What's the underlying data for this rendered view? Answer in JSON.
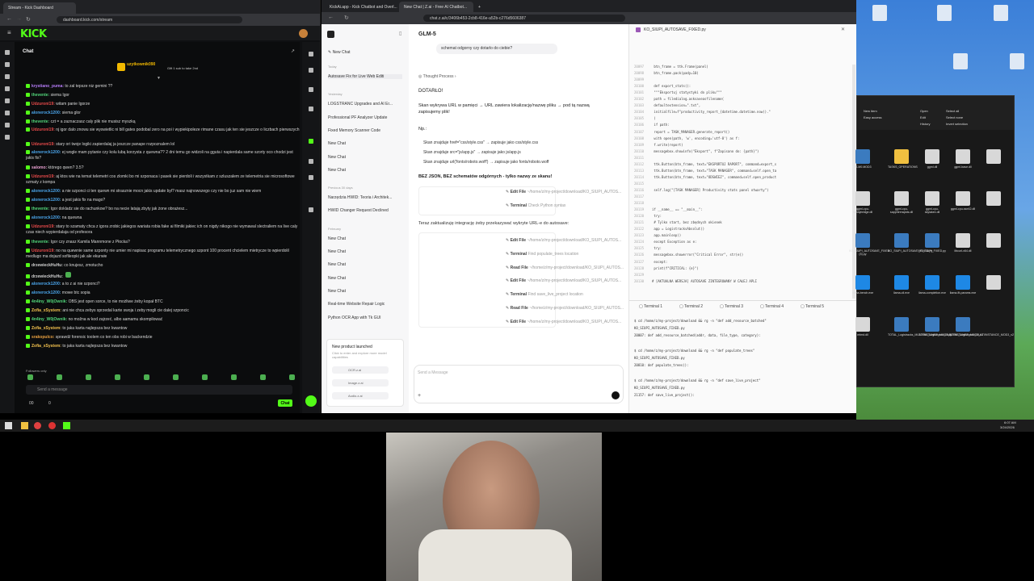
{
  "colors": {
    "kick": "#53fc18",
    "accent": "#2d6cdf"
  },
  "left_browser": {
    "tab": "Stream - Kick Dashboard",
    "url": "dashboard.kick.com/stream",
    "logo": "KICK",
    "chat_title": "Chat",
    "pinned_user": "uzytkownik090",
    "pinned_text": "Gift 1 sub to take 2nd",
    "messages": [
      {
        "u": "krystiano_puma:",
        "t": "to zal tepsze niz gemini ??",
        "c": "#b57cf7"
      },
      {
        "u": "thevente:",
        "t": "siema Igor",
        "c": "#52d67a"
      },
      {
        "u": "Udzuroni19:",
        "t": "witam panie Igorze",
        "c": "#e84a4a"
      },
      {
        "u": "alonerock1200:",
        "t": "siema glor",
        "c": "#4aa3e8"
      },
      {
        "u": "thevente:",
        "t": "czt = a zaznaczasz caly plik nie musisz myszką",
        "c": "#52d67a"
      },
      {
        "u": "Udzuroni19:",
        "t": "nj igor dalo znowu sie wyswietlic ni bill gates podobal zero na poi i wypiekipoleze rimane czasu jak ten sie jeszcze o liczbach pierwszych",
        "c": "#e84a4a"
      },
      {
        "u": "Udzuroni19:",
        "t": "stary ori twoje logiki zapierdalaj ja jeszcze panape rozpoznalem lol",
        "c": "#e84a4a"
      },
      {
        "u": "alonerock1200:",
        "t": "ej wogle mam pytanie czy kolu lubą korzysta z quewna?? 2 dni temu go widzoli na gguta i napierdala same szorty oco chodzi jest jakis fix?",
        "c": "#4aa3e8"
      },
      {
        "u": "salomo:",
        "t": "którego qwen? 3.5?",
        "c": "#e8a0d0"
      },
      {
        "u": "Udzuroni19:",
        "t": "aj ktos wie na temat telemetri cos zlomki bo mi szponaca i pasek sie pierdoli i wszystkam z szluszalem ze telemetria sie microsoftowe szmaty z kompa",
        "c": "#e84a4a"
      },
      {
        "u": "alonerock1200:",
        "t": "a nie szponci ci ten quewn mi strasznie mocn jakis update byl? masz najnowszego czy nie bo juz sam nie wiem",
        "c": "#4aa3e8"
      },
      {
        "u": "alonerock1200:",
        "t": "a jest jakis fix na mago?",
        "c": "#4aa3e8"
      },
      {
        "u": "thevente:",
        "t": "Igor dokladz sie do rachunkow? bo na necie latają zbyty jak żone obrażesz...",
        "c": "#52d67a"
      },
      {
        "u": "alonerock1200:",
        "t": "na quewna",
        "c": "#4aa3e8"
      },
      {
        "u": "Udzuroni19:",
        "t": "stary to szamaty chca z igora zrobic jakiegos wariata robia fake ai filmiki jakiec ich on nigdy nikogo nie wymawal slectraliem na live caly czas niech wypierdalaja od profesora",
        "c": "#e84a4a"
      },
      {
        "u": "thevente:",
        "t": "Igor czy znasz Kamila Mannmone z Płocka?",
        "c": "#52d67a"
      },
      {
        "u": "Udzuroni19:",
        "t": "no na quewnie same szponty nie umier mi napisac programu telemetrycznego szpont 100 procent chcielem mietrycze to wpierdolil medlugo ma dojazd sofileopki jak ale ekurwie",
        "c": "#e84a4a"
      },
      {
        "u": "drzewieckHuHu:",
        "t": "co knujesz, zmotucho",
        "c": "#d0d0d0"
      },
      {
        "u": "drzewieckHuHu:",
        "t": "",
        "c": "#d0d0d0"
      },
      {
        "u": "alonerock1200:",
        "t": "a to z ai nie szponci?",
        "c": "#4aa3e8"
      },
      {
        "u": "alonerock1200:",
        "t": "mowe btc sopia",
        "c": "#4aa3e8"
      },
      {
        "u": "4n4iny_W0jOwnik:",
        "t": "OBS jest open sorce, to nie możliwe żeby kopał BTC",
        "c": "#52d67a"
      },
      {
        "u": "Zofia_xSystem:",
        "t": "ani nie chca zebys sprzedal karte swoja i zeby mogli cie dalej szponcic",
        "c": "#f2c14e"
      },
      {
        "u": "4n4iny_W0jOwnik:",
        "t": "no možna w kod zajrzeć, albo aamamu skompilować",
        "c": "#52d67a"
      },
      {
        "u": "Zofia_xSystem:",
        "t": "to jaka karta najlepsza bez kwantow",
        "c": "#f2c14e"
      },
      {
        "u": "srakopulco:",
        "t": "sprawdź forensic toolem co ten obs robi w backendzie",
        "c": "#e8a040"
      },
      {
        "u": "Zofia_xSystem:",
        "t": "to jaka karta najlepsza bez kwantow",
        "c": "#f2c14e"
      }
    ],
    "followers_only": "Followers only",
    "send_placeholder": "Send a message",
    "count_a": "00",
    "count_b": "0",
    "chat_button": "Chat"
  },
  "middle_browser": {
    "tabs": [
      "KickAi.app - Kick Chatbot and Overl...",
      "New Chat | Z.ai - Free AI Chatbot...",
      "+"
    ],
    "url": "chat.z.ai/c/3406b453-2cb8-416e-a52b-c276d5606387",
    "model": "GLM-5",
    "sidebar": {
      "new_chat": "New Chat",
      "sections": [
        {
          "h": "Today",
          "items": [
            "Autosave Fix for Live Web Editi"
          ]
        },
        {
          "h": "Yesterday",
          "items": [
            "LOGSTRANC Upgrades and AI Er...",
            "Professional PF Analyzer Update",
            "Fixed Memory Scanner Code",
            "New Chat",
            "New Chat",
            "New Chat"
          ]
        },
        {
          "h": "Previous 30 days",
          "items": [
            "Narzędzia HWID: Teoria i Architek...",
            "HWID Changer Request Declined"
          ]
        },
        {
          "h": "February",
          "items": [
            "New Chat",
            "New Chat",
            "New Chat",
            "New Chat",
            "New Chat",
            "Real-time Website Repair Logic",
            "Python OCR App with Tk GUI"
          ]
        }
      ],
      "promo_title": "New product launched",
      "promo_text": "Click to enter and explore more model capabilities",
      "promo_items": [
        "OCR.z.ai",
        "Image.z.ai",
        "Audio.z.ai"
      ]
    },
    "chat": {
      "user_msg": "schemat odgorny czy dotarlo do ciebie?",
      "thinking": "Thought Process",
      "p1": "DOTARŁO!",
      "p2": "Skan wykrywa URL w pamięci → URL zawiera lokalizację/nazwę pliku → pod tą nazwą zapisujemy plik!",
      "np": "Np.:",
      "bullets": [
        "Skan znajduje href=\"css/style.css\" → zapisuje jako css/style.css",
        "Skan znajduje src=\"js/app.js\" → zapisuje jako js/app.js",
        "Skan znajduje url('fonts/roboto.woff') → zapisuje jako fonts/roboto.woff"
      ],
      "bold_note": "BEZ JSON, BEZ schematów odgórnych - tylko nazwy ze skanu!",
      "tools1": [
        [
          "Edit File",
          "~/home/z/my-project/download/KO_SIUPI_AUTOS..."
        ],
        [
          "Terminal",
          "Check Python syntax"
        ]
      ],
      "p3": "Teraz zaktualizuję integrację żeby przekazywać wykryte URL-e do autosave:",
      "tools2": [
        [
          "Edit File",
          "~/home/z/my-project/download/KO_SIUPI_AUTOS..."
        ],
        [
          "Terminal",
          "Find populate_trees location"
        ],
        [
          "Read File",
          "~/home/z/my-project/download/KO_SIUPI_AUTOS..."
        ],
        [
          "Edit File",
          "~/home/z/my-project/download/KO_SIUPI_AUTOS..."
        ],
        [
          "Terminal",
          "Find save_live_project location"
        ],
        [
          "Read File",
          "~/home/z/my-project/download/KO_SIUPI_AUTOS..."
        ],
        [
          "Edit File",
          "~/home/z/my-project/download/KO_SIUPI_AUTOS..."
        ]
      ],
      "input_placeholder": "Send a Message"
    },
    "code": {
      "filename": "KO_SIUPI_AUTOSAVE_FIXED.py",
      "lines": [
        [
          "20097",
          "    btn_frame = ttk.Frame(panel)"
        ],
        [
          "20098",
          "    btn_frame.pack(pady=10)"
        ],
        [
          "20099",
          ""
        ],
        [
          "20100",
          "    def export_stats():"
        ],
        [
          "20101",
          "        \"\"\"Eksportuj statystyki do pliku\"\"\""
        ],
        [
          "20102",
          "        path = filedialog.asksaveasfilename("
        ],
        [
          "20103",
          "            defaultextension=\".txt\","
        ],
        [
          "20104",
          "            initialfile=f\"productivity_report_{datetime.datetime.now().\""
        ],
        [
          "20105",
          "        )"
        ],
        [
          "20106",
          "        if path:"
        ],
        [
          "20107",
          "            report = TASK_MANAGER.generate_report()"
        ],
        [
          "20108",
          "            with open(path, 'w', encoding='utf-8') as f:"
        ],
        [
          "20109",
          "                f.write(report)"
        ],
        [
          "20110",
          "            messagebox.showinfo(\"Eksport\", f\"Zapisano do: {path}\")"
        ],
        [
          "20111",
          ""
        ],
        [
          "20112",
          "    ttk.Button(btn_frame, text=\"EKSPORTUJ RAPORT\", command=export_s"
        ],
        [
          "20113",
          "    ttk.Button(btn_frame, text=\"TASK MANAGER\", command=self.open_ta"
        ],
        [
          "20114",
          "    ttk.Button(btn_frame, text=\"ODSWIEZ\", command=self.open_product"
        ],
        [
          "20115",
          ""
        ],
        [
          "20116",
          "    self.log(\"[TASK MANAGER] Productivity stats panel otwarty\")"
        ],
        [
          "20117",
          ""
        ],
        [
          "20118",
          ""
        ],
        [
          "20119",
          "if __name__ == \"__main__\":"
        ],
        [
          "20120",
          "    try:"
        ],
        [
          "20121",
          "        # Tylko start, bez zbędnych okienek"
        ],
        [
          "20122",
          "        app = LogistracksAbsolut()"
        ],
        [
          "20123",
          "        app.mainloop()"
        ],
        [
          "20124",
          "    except Exception as e:"
        ],
        [
          "20125",
          "        try:"
        ],
        [
          "20126",
          "            messagebox.showerror(\"Critical Error\", str(e))"
        ],
        [
          "20127",
          "        except:"
        ],
        [
          "20128",
          "            print(f\"CRITICAL: {e}\")"
        ],
        [
          "20129",
          ""
        ],
        [
          "20130",
          "# [AKTUALNA WERSJA] AUTOSAVE ZINTEGROWANY W CAŁEJ APLI"
        ]
      ],
      "term_tabs": [
        "Terminal 1",
        "Terminal 2",
        "Terminal 3",
        "Terminal 4",
        "Terminal 5"
      ],
      "term_lines": [
        "$ cd /home/z/my-project/download && rg -n \"def add_resource_batched\"",
        "KO_SIUPI_AUTOSAVE_FIXED.py",
        "20007:        def add_resource_batched(addr, data, file_type, category):",
        "",
        "$ cd /home/z/my-project/download && rg -n \"def populate_trees\"",
        "KO_SIUPI_AUTOSAVE_FIXED.py",
        "20810:        def populate_trees():",
        "",
        "$ cd /home/z/my-project/download && rg -n \"def save_live_project\"",
        "KO_SIUPI_AUTOSAVE_FIXED.py",
        "21157:        def save_live_project():"
      ]
    }
  },
  "explorer": {
    "toolbar": [
      "Open",
      "Edit",
      "History",
      "Select all",
      "Select none",
      "Invert selection",
      "New item",
      "Easy access"
    ],
    "files": [
      "IR-M0.MOD3",
      "TASKS_OPERATIONS",
      "ggml.dll",
      "ggml-base.dll",
      "",
      "ggml-cpu-sandybridge.dll",
      "ggml-cpu-sapphirerapids.dll",
      "ggml-cpu-skylakex.dll",
      "ggml-cpu-sse42.dll",
      "",
      "KO_SIUPI_AUTOSAVE_FIXED (5).py",
      "KO_SIUPI_AUTOSAVE_FIXED.py",
      "KO_SIUPI_FIXED.py",
      "libcurl-x64.dll",
      "",
      "llama-bench.exe",
      "llama-cli.exe",
      "llama-completion.exe",
      "llama-fit-params.exe",
      "",
      "mtmd.dll",
      "TOTAL_Logistracks_MULTIINSTANCE_MOD3.py",
      "TOTAL_Logistracks_MULTIINSTANCE_MOD3_v1",
      "TOTAL_Logistracks_MULTIINSTANCE_MOD3_v2"
    ]
  },
  "taskbar": {
    "time": "6:07 AM",
    "date": "3/24/2026"
  }
}
